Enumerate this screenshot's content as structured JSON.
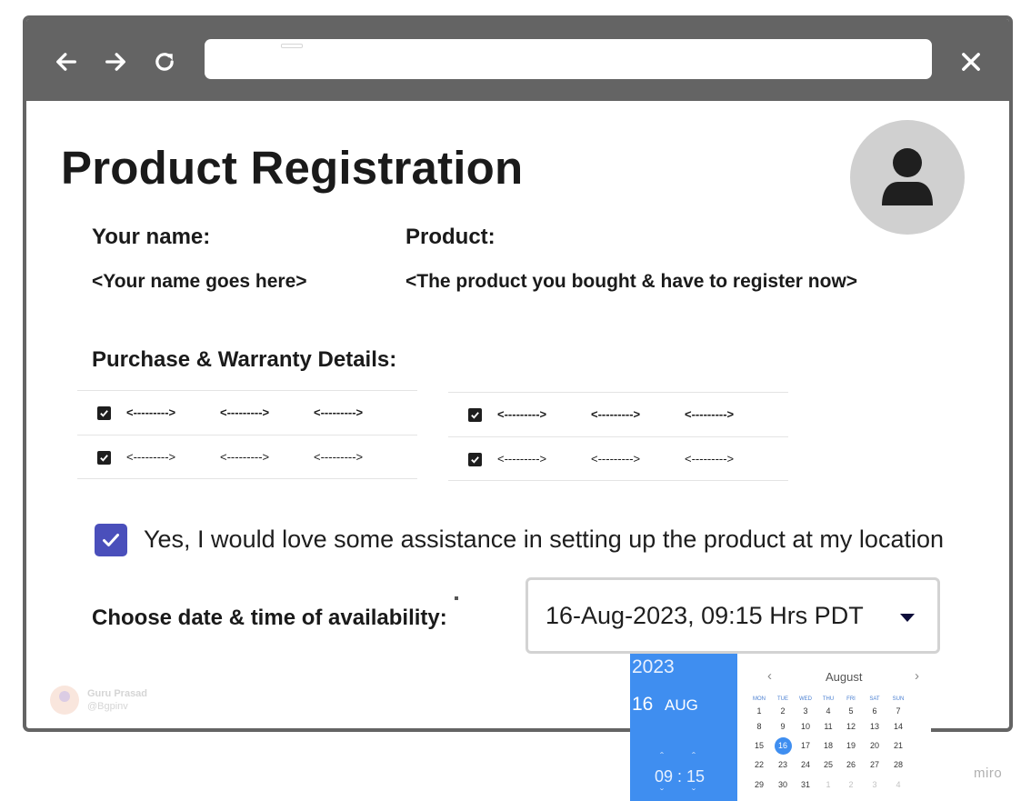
{
  "browser": {
    "address_placeholder": ""
  },
  "page": {
    "title": "Product Registration"
  },
  "form": {
    "name_label": "Your name:",
    "name_value": "<Your name goes here>",
    "product_label": "Product:",
    "product_value": "<The product you bought & have to register now>",
    "details_label": "Purchase & Warranty Details:"
  },
  "details": {
    "left": [
      {
        "checked": true,
        "cells": [
          "<--------->",
          "<--------->",
          "<--------->"
        ]
      },
      {
        "checked": true,
        "cells": [
          "<--------->",
          "<--------->",
          "<--------->"
        ]
      }
    ],
    "right": [
      {
        "checked": true,
        "cells": [
          "<--------->",
          "<--------->",
          "<--------->"
        ]
      },
      {
        "checked": true,
        "cells": [
          "<--------->",
          "<--------->",
          "<--------->"
        ]
      }
    ]
  },
  "assist": {
    "checked": true,
    "label": "Yes, I would love some assistance in setting up the product at my location"
  },
  "availability": {
    "label": "Choose date & time of availability:",
    "value": "16-Aug-2023, 09:15 Hrs PDT"
  },
  "datepicker": {
    "year": "2023",
    "day": "16",
    "month_short": "AUG",
    "time": "09 : 15",
    "month": "August",
    "weekdays": [
      "MON",
      "TUE",
      "WED",
      "THU",
      "FRI",
      "SAT",
      "SUN"
    ],
    "weeks": [
      [
        "1",
        "2",
        "3",
        "4",
        "5",
        "6",
        "7"
      ],
      [
        "8",
        "9",
        "10",
        "11",
        "12",
        "13",
        "14"
      ],
      [
        "15",
        "16",
        "17",
        "18",
        "19",
        "20",
        "21"
      ],
      [
        "22",
        "23",
        "24",
        "25",
        "26",
        "27",
        "28"
      ],
      [
        "29",
        "30",
        "31",
        "1",
        "2",
        "3",
        "4"
      ]
    ],
    "selected": "16"
  },
  "watermark": {
    "name": "Guru Prasad",
    "handle": "@Bgpinv"
  },
  "brand": {
    "logo": "miro"
  },
  "colors": {
    "toolbar": "#646464",
    "accent_checkbox": "#4a4fbb",
    "datepicker_blue": "#3f8ef0",
    "avatar_bg": "#d0d0d0"
  },
  "icons": {
    "back": "arrow-left-icon",
    "forward": "arrow-right-icon",
    "reload": "reload-icon",
    "close": "close-icon",
    "user": "user-icon",
    "caret": "caret-down-icon"
  }
}
